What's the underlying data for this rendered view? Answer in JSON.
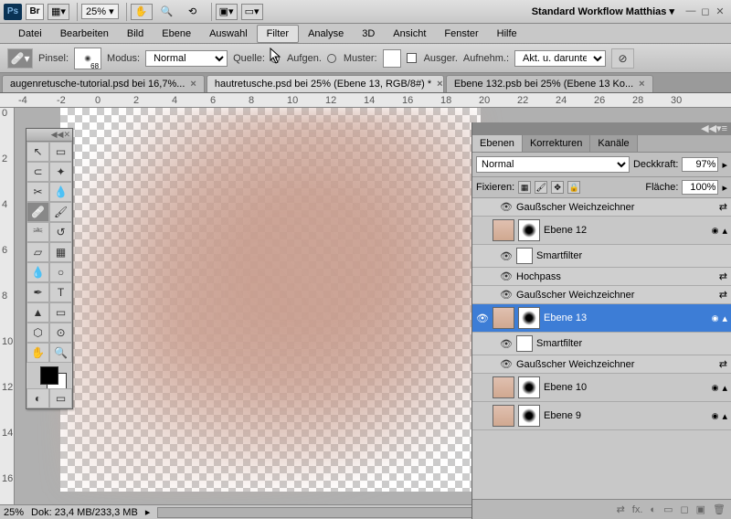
{
  "topbar": {
    "ps": "Ps",
    "br": "Br",
    "zoom": "25%",
    "workspace": "Standard Workflow Matthias ▾"
  },
  "menu": [
    "Datei",
    "Bearbeiten",
    "Bild",
    "Ebene",
    "Auswahl",
    "Filter",
    "Analyse",
    "3D",
    "Ansicht",
    "Fenster",
    "Hilfe"
  ],
  "options": {
    "pinsel_label": "Pinsel:",
    "brush_size": "68",
    "modus_label": "Modus:",
    "modus_value": "Normal",
    "quelle_label": "Quelle:",
    "aufgen": "Aufgen.",
    "muster": "Muster:",
    "ausger": "Ausger.",
    "aufnehm_label": "Aufnehm.:",
    "aufnehm_value": "Akt. u. darunter"
  },
  "tabs": [
    {
      "label": "augenretusche-tutorial.psd bei 16,7%...",
      "active": false
    },
    {
      "label": "hautretusche.psd bei 25% (Ebene 13, RGB/8#) *",
      "active": true
    },
    {
      "label": "Ebene 132.psb bei 25% (Ebene 13 Ko...",
      "active": false
    }
  ],
  "ruler_h": [
    "-4",
    "-2",
    "0",
    "2",
    "4",
    "6",
    "8",
    "10",
    "12",
    "14",
    "16",
    "18",
    "20",
    "22",
    "24",
    "26",
    "28",
    "30"
  ],
  "ruler_v": [
    "0",
    "2",
    "4",
    "6",
    "8",
    "10",
    "12",
    "14",
    "16"
  ],
  "panels": {
    "tabs": [
      "Ebenen",
      "Korrekturen",
      "Kanäle"
    ],
    "blend_mode": "Normal",
    "deckkraft_label": "Deckkraft:",
    "deckkraft": "97%",
    "fixieren_label": "Fixieren:",
    "flaeche_label": "Fläche:",
    "flaeche": "100%"
  },
  "layers": [
    {
      "type": "filter",
      "name": "Gaußscher Weichzeichner",
      "eye": "👁"
    },
    {
      "type": "layer",
      "name": "Ebene 12",
      "eye": "",
      "thumb": "face"
    },
    {
      "type": "smart",
      "name": "Smartfilter",
      "eye": "👁"
    },
    {
      "type": "filter",
      "name": "Hochpass",
      "eye": "👁"
    },
    {
      "type": "filter",
      "name": "Gaußscher Weichzeichner",
      "eye": "👁"
    },
    {
      "type": "layer",
      "name": "Ebene 13",
      "eye": "👁",
      "selected": true,
      "thumb": "face"
    },
    {
      "type": "smart",
      "name": "Smartfilter",
      "eye": "👁"
    },
    {
      "type": "filter",
      "name": "Gaußscher Weichzeichner",
      "eye": "👁"
    },
    {
      "type": "layer",
      "name": "Ebene 10",
      "eye": "",
      "thumb": "gray"
    },
    {
      "type": "layer",
      "name": "Ebene 9",
      "eye": "",
      "thumb": "face"
    }
  ],
  "footer_icons": [
    "⇄",
    "fx.",
    "◐",
    "▭",
    "◻",
    "▣",
    "🗑"
  ],
  "status": {
    "zoom": "25%",
    "dok": "Dok: 23,4 MB/233,3 MB"
  }
}
